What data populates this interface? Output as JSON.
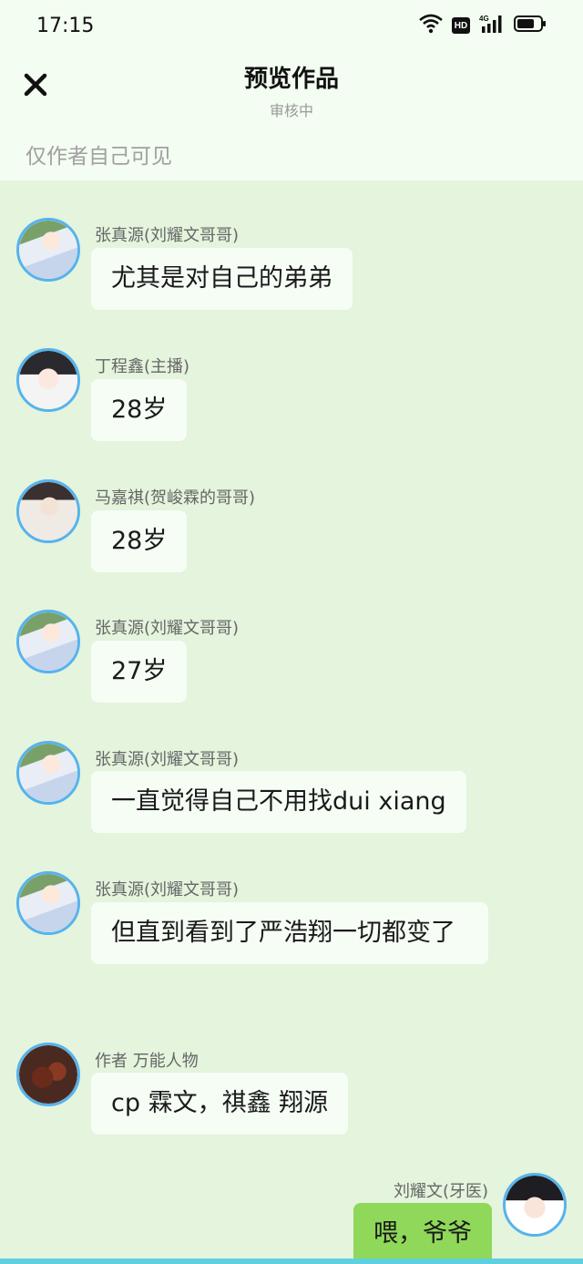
{
  "status_bar": {
    "time": "17:15",
    "icons": [
      "wifi-icon",
      "hd-icon",
      "signal-4g-icon",
      "battery-icon"
    ],
    "hd_label": "HD"
  },
  "header": {
    "title": "预览作品",
    "subtitle": "审核中",
    "visibility_note": "仅作者自己可见",
    "close_icon": "close-icon"
  },
  "messages": [
    {
      "sender": "张真源(刘耀文哥哥)",
      "text": "尤其是对自己的弟弟",
      "side": "left"
    },
    {
      "sender": "丁程鑫(主播)",
      "text": "28岁",
      "side": "left"
    },
    {
      "sender": "马嘉祺(贺峻霖的哥哥)",
      "text": "28岁",
      "side": "left"
    },
    {
      "sender": "张真源(刘耀文哥哥)",
      "text": "27岁",
      "side": "left"
    },
    {
      "sender": "张真源(刘耀文哥哥)",
      "text": "一直觉得自己不用找dui xiang",
      "side": "left"
    },
    {
      "sender": "张真源(刘耀文哥哥)",
      "text": "但直到看到了严浩翔一切都变了",
      "side": "left"
    },
    {
      "sender": "作者 万能人物",
      "text": "cp 霖文，祺鑫 翔源",
      "side": "left"
    },
    {
      "sender": "刘耀文(牙医)",
      "text": "喂，爷爷",
      "side": "right"
    }
  ],
  "colors": {
    "background": "#e4f4dd",
    "header_bg": "#f3fdf1",
    "bubble_left": "#f5fdf5",
    "bubble_right": "#8fd85a",
    "avatar_ring": "#56b3ec"
  }
}
